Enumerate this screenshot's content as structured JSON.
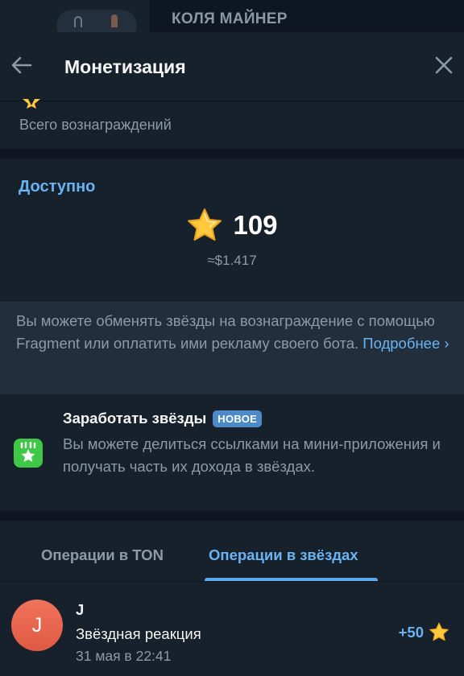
{
  "background_chat": {
    "title": "КОЛЯ МАЙНЕР"
  },
  "header": {
    "title": "Монетизация",
    "back_icon": "arrow-left-icon",
    "close_icon": "close-icon"
  },
  "total_rewards": {
    "label": "Всего вознаграждений"
  },
  "available": {
    "title": "Доступно",
    "balance": "109",
    "usd": "≈$1.417",
    "icon": "star-icon"
  },
  "info": {
    "text": "Вы можете обменять звёзды на вознаграждение с помощью Fragment или оплатить ими рекламу своего бота. ",
    "link_label": "Подробнее ›"
  },
  "earn": {
    "title": "Заработать звёзды",
    "badge": "НОВОЕ",
    "description": "Вы можете делиться ссылками на мини-приложения и получать часть их дохода в звёздах.",
    "icon": "affiliate-star-icon"
  },
  "tabs": [
    {
      "label": "Операции в TON",
      "active": false
    },
    {
      "label": "Операции в звёздах",
      "active": true
    }
  ],
  "transactions": [
    {
      "avatar_letter": "J",
      "name": "J",
      "type": "Звёздная реакция",
      "date": "31 мая в 22:41",
      "amount": "+50",
      "icon": "star-icon"
    }
  ],
  "colors": {
    "accent": "#6ab3f3",
    "background": "#17212b",
    "secondary_bg": "#232e3c",
    "muted_text": "#8d9aa7",
    "star": "#ffc83d",
    "badge": "#4d8bc8",
    "earn_icon_bg": "#3fc846",
    "avatar": "#e9644d"
  }
}
